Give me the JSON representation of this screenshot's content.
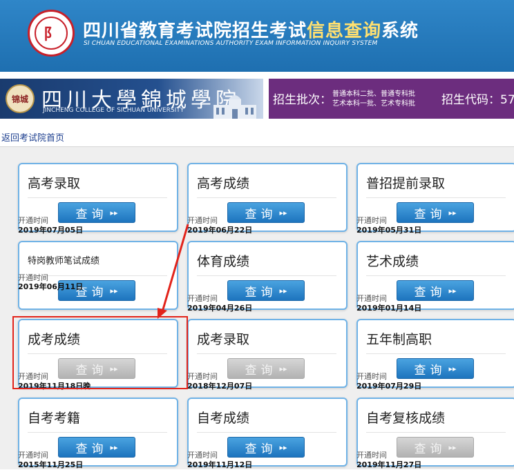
{
  "header": {
    "emblem_char": "阝",
    "title_part1": "四川省教育考试院招生考试",
    "title_part2": "信息查询",
    "title_part3": "系统",
    "subtitle": "SI CHUAN EDUCATIONAL EXAMINATIONS AUTHORITY EXAM INFORMATION INQUIRY SYSTEM"
  },
  "banner": {
    "school_badge": "锦城",
    "school_name_cn": "四川大學錦城學院",
    "school_name_en": "JINCHENG COLLEGE OF SICHUAN UNIVERSITY",
    "batch_label": "招生批次：",
    "batch_value_1": "普通本科二批、普通专科批",
    "batch_value_2": "艺术本科一批、艺术专科批",
    "code_label": "招生代码：57"
  },
  "nav": {
    "back_link": "返回考试院首页"
  },
  "button": {
    "label": "查询",
    "arrow": "▸▸"
  },
  "cards": [
    {
      "title": "高考录取",
      "open_label": "开通时间",
      "open_date": "2019年07月05日",
      "enabled": true
    },
    {
      "title": "高考成绩",
      "open_label": "开通时间",
      "open_date": "2019年06月22日",
      "enabled": true
    },
    {
      "title": "普招提前录取",
      "open_label": "开通时间",
      "open_date": "2019年05月31日",
      "enabled": true
    },
    {
      "title": "特岗教师笔试成绩",
      "open_label": "开通时间",
      "open_date": "2019年06月11日",
      "enabled": true
    },
    {
      "title": "体育成绩",
      "open_label": "开通时间",
      "open_date": "2019年04月26日",
      "enabled": true
    },
    {
      "title": "艺术成绩",
      "open_label": "开通时间",
      "open_date": "2019年01月14日",
      "enabled": true
    },
    {
      "title": "成考成绩",
      "open_label": "开通时间",
      "open_date": "2019年11月18日晚",
      "enabled": false
    },
    {
      "title": "成考录取",
      "open_label": "开通时间",
      "open_date": "2018年12月07日",
      "enabled": false
    },
    {
      "title": "五年制高职",
      "open_label": "开通时间",
      "open_date": "2019年07月29日",
      "enabled": true
    },
    {
      "title": "自考考籍",
      "open_label": "开通时间",
      "open_date": "2015年11月25日",
      "enabled": true
    },
    {
      "title": "自考成绩",
      "open_label": "开通时间",
      "open_date": "2019年11月12日",
      "enabled": true
    },
    {
      "title": "自考复核成绩",
      "open_label": "开通时间",
      "open_date": "2019年11月27日",
      "enabled": false
    }
  ],
  "colors": {
    "header_bg": "#1e6fb0",
    "title_highlight": "#ffe070",
    "batch_bg": "#6c2d7e",
    "button_blue": "#1d74be",
    "card_border": "#6fb2e6",
    "highlight_red": "#e2231a"
  }
}
